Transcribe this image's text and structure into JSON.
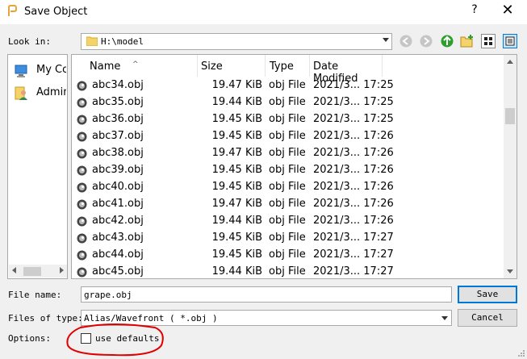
{
  "window": {
    "title": "Save Object",
    "help": "?",
    "close": "✕"
  },
  "lookin": {
    "label": "Look in:",
    "path": "H:\\model"
  },
  "toolbar": {
    "icons": [
      "back-icon",
      "forward-icon",
      "parent-folder-icon",
      "new-folder-icon",
      "list-view-icon",
      "detail-view-icon"
    ]
  },
  "places": [
    {
      "label": "My Computer",
      "icon": "computer-icon"
    },
    {
      "label": "Administrator",
      "icon": "user-icon"
    }
  ],
  "columns": {
    "name": "Name",
    "size": "Size",
    "type": "Type",
    "date": "Date Modified"
  },
  "files": [
    {
      "name": "abc34.obj",
      "size": "19.47 KiB",
      "type": "obj File",
      "date": "2021/3...",
      "time": "17:25"
    },
    {
      "name": "abc35.obj",
      "size": "19.44 KiB",
      "type": "obj File",
      "date": "2021/3...",
      "time": "17:25"
    },
    {
      "name": "abc36.obj",
      "size": "19.45 KiB",
      "type": "obj File",
      "date": "2021/3...",
      "time": "17:25"
    },
    {
      "name": "abc37.obj",
      "size": "19.45 KiB",
      "type": "obj File",
      "date": "2021/3...",
      "time": "17:26"
    },
    {
      "name": "abc38.obj",
      "size": "19.47 KiB",
      "type": "obj File",
      "date": "2021/3...",
      "time": "17:26"
    },
    {
      "name": "abc39.obj",
      "size": "19.45 KiB",
      "type": "obj File",
      "date": "2021/3...",
      "time": "17:26"
    },
    {
      "name": "abc40.obj",
      "size": "19.45 KiB",
      "type": "obj File",
      "date": "2021/3...",
      "time": "17:26"
    },
    {
      "name": "abc41.obj",
      "size": "19.47 KiB",
      "type": "obj File",
      "date": "2021/3...",
      "time": "17:26"
    },
    {
      "name": "abc42.obj",
      "size": "19.44 KiB",
      "type": "obj File",
      "date": "2021/3...",
      "time": "17:26"
    },
    {
      "name": "abc43.obj",
      "size": "19.45 KiB",
      "type": "obj File",
      "date": "2021/3...",
      "time": "17:27"
    },
    {
      "name": "abc44.obj",
      "size": "19.45 KiB",
      "type": "obj File",
      "date": "2021/3...",
      "time": "17:27"
    },
    {
      "name": "abc45.obj",
      "size": "19.44 KiB",
      "type": "obj File",
      "date": "2021/3...",
      "time": "17:27"
    }
  ],
  "filename": {
    "label": "File name:",
    "value": "grape.obj"
  },
  "filetype": {
    "label": "Files of type:",
    "value": "Alias/Wavefront ( *.obj )"
  },
  "options": {
    "label": "Options:",
    "checkbox_label": "use defaults",
    "checked": false
  },
  "buttons": {
    "save": "Save",
    "cancel": "Cancel"
  },
  "colors": {
    "accent": "#0078d7",
    "annotation": "#e00000",
    "nav_green": "#2e9e2e"
  }
}
